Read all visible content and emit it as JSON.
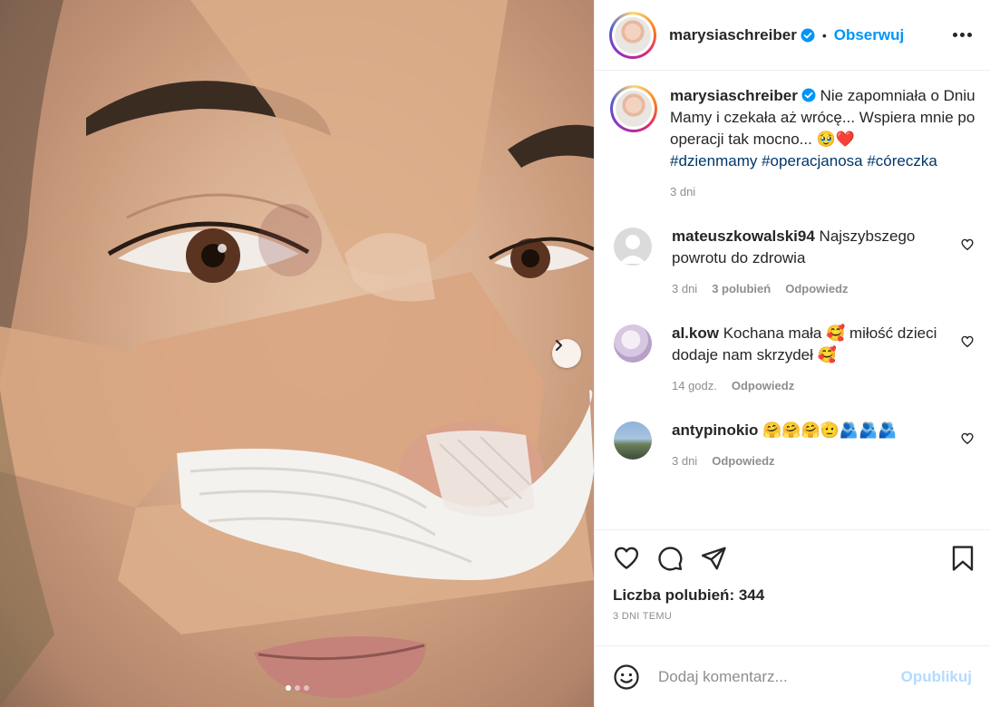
{
  "post": {
    "username": "marysiaschreiber",
    "separator": "•",
    "follow_label": "Obserwuj",
    "caption_text": "Nie zapomniała o Dniu Mamy i czekała aż wrócę... Wspiera mnie po operacji tak mocno... 🥹❤️",
    "hashtags": "#dzienmamy #operacjanosa #córeczka",
    "caption_time": "3 dni",
    "likes_label": "Liczba polubień: 344",
    "date_label": "3 DNI TEMU",
    "carousel": {
      "slides": 3,
      "active": 1
    }
  },
  "comments": [
    {
      "username": "mateuszkowalski94",
      "text": "Najszybszego powrotu do zdrowia",
      "time": "3 dni",
      "likes": "3 polubień",
      "reply": "Odpowiedz"
    },
    {
      "username": "al.kow",
      "text": "Kochana mała 🥰 miłość dzieci dodaje nam skrzydeł 🥰",
      "time": "14 godz.",
      "reply": "Odpowiedz"
    },
    {
      "username": "antypinokio",
      "text": "🤗🤗🤗🫡🫂🫂🫂",
      "time": "3 dni",
      "reply": "Odpowiedz"
    }
  ],
  "composer": {
    "placeholder": "Dodaj komentarz...",
    "publish_label": "Opublikuj"
  },
  "colors": {
    "accent": "#0095f6",
    "hashtag": "#00376b",
    "muted": "#8e8e8e",
    "publish_disabled": "#b3dbff"
  },
  "icons": {
    "verified": "verified-badge-icon",
    "more": "more-options-icon",
    "like": "heart-icon",
    "comment": "comment-bubble-icon",
    "share": "paper-plane-icon",
    "save": "bookmark-icon",
    "emoji": "smiley-icon",
    "next": "chevron-right-icon"
  }
}
